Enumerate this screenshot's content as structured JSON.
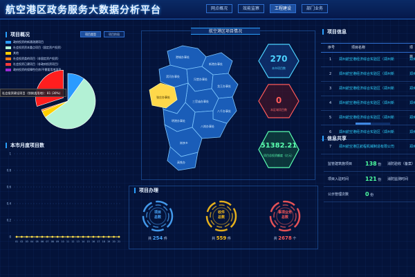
{
  "header": {
    "title": "航空港区政务服务大数据分析平台",
    "nav": [
      "网点概况",
      "效能监察",
      "工程建设",
      "部门业务"
    ],
    "active_nav": 2
  },
  "overview": {
    "title": "项目概况",
    "tabs": [
      "项目类型",
      "项目阶段"
    ],
    "legend": [
      {
        "label": "政府投资的新建改建项目",
        "color": "#2a9bff"
      },
      {
        "label": "社会投资资本重点项目（固定资产投资）",
        "color": "#b3f1d5"
      },
      {
        "label": "其他",
        "color": "#ffd000"
      },
      {
        "label": "社会投资类的项目（非固定资产投资）",
        "color": "#ff7a1a"
      },
      {
        "label": "社会投资已建项目（非政府投资项目）",
        "color": "#ff3b3b"
      },
      {
        "label": "政府投资的保障性住房/不需要用地项目",
        "color": "#9b2bd6"
      }
    ],
    "tooltip": "社会投资建设项目（划拨类用地）：81 (30%)"
  },
  "chart_data": [
    {
      "type": "pie",
      "categories": [
        "政府投资的新建改建项目",
        "社会投资资本重点项目（固定资产投资）",
        "其他",
        "社会投资类的项目（非固定资产投资）",
        "社会投资已建项目（非政府投资项目）"
      ],
      "values": [
        0.1,
        0.55,
        0.04,
        0.01,
        0.3
      ],
      "colors": [
        "#2a9bff",
        "#b3f1d5",
        "#ffd000",
        "#ff7a1a",
        "#ff1e1e"
      ]
    },
    {
      "type": "line",
      "title": "本市月度项目数",
      "categories": [
        "01",
        "02",
        "03",
        "04",
        "05",
        "06",
        "07",
        "08",
        "09",
        "10",
        "11",
        "12",
        "13",
        "14",
        "15",
        "16",
        "17",
        "18",
        "19",
        "20",
        "21"
      ],
      "values": [
        0,
        0,
        0,
        0,
        0,
        0,
        0,
        0,
        0,
        0,
        0,
        0,
        0,
        0,
        0,
        0,
        0,
        0,
        0,
        0,
        0
      ],
      "yticks": [
        0,
        0.2,
        0.4,
        0.6,
        0.8,
        1
      ],
      "ylim": [
        0,
        1
      ]
    }
  ],
  "map": {
    "title": "航空港区项目情况",
    "districts": [
      "港城办事处",
      "新港办事处",
      "滨河办事处",
      "冯堂办事处",
      "龙王办事处",
      "张庄办事处",
      "三官庙办事处",
      "八千办事处",
      "明港办事处",
      "八岗办事处",
      "岗李乡",
      "高铁办"
    ]
  },
  "kpi": [
    {
      "value": "270",
      "label": "本市项目数",
      "color": "#4dd2ff"
    },
    {
      "value": "0",
      "label": "本区域项目数",
      "color": "#ff5a5a"
    },
    {
      "value": "51382.21",
      "label": "项目总投资额度（亿元）",
      "color": "#5affb0"
    }
  ],
  "project_info": {
    "title": "项目信息",
    "columns": [
      "序号",
      "项目名称",
      "项目"
    ],
    "rows": [
      {
        "no": "1",
        "name": "郑州航空港经济综合实验区（郑州新",
        "tag": "郑州"
      },
      {
        "no": "2",
        "name": "郑州航空港经济综合实验区（郑州新",
        "tag": "郑州"
      },
      {
        "no": "3",
        "name": "郑州航空港经济综合实验区（郑州新",
        "tag": "郑州"
      },
      {
        "no": "4",
        "name": "郑州航空港经济综合实验区（郑州新",
        "tag": "郑州"
      },
      {
        "no": "5",
        "name": "郑州航空港经济综合实验区（郑州新",
        "tag": "郑州"
      },
      {
        "no": "6",
        "name": "郑州航空港经济综合实验区（郑州新",
        "tag": "郑州"
      },
      {
        "no": "7",
        "name": "郑州航空港区航程机械制造有限公司",
        "tag": "郑州"
      }
    ]
  },
  "share": {
    "title": "信息共享",
    "rows": [
      {
        "left": "监管建筑施项目",
        "num": "138",
        "unit": "份",
        "right": "消防验收（备案）"
      },
      {
        "left": "项目入驻时间",
        "num": "121",
        "unit": "份",
        "right": "消防监测时间"
      },
      {
        "left": "公示管理次数",
        "num": "0",
        "unit": "份",
        "right": ""
      }
    ]
  },
  "handling": {
    "title": "项目办理",
    "rings": [
      {
        "center1": "项目",
        "center2": "总数",
        "text": "共",
        "num": "254",
        "unit": "件",
        "color": "#4aa8ff"
      },
      {
        "center1": "收件",
        "center2": "总数",
        "text": "共",
        "num": "559",
        "unit": "件",
        "color": "#ffc21a"
      },
      {
        "center1": "事项业务",
        "center2": "总数",
        "text": "共",
        "num": "2678",
        "unit": "个",
        "color": "#ff5a5a"
      }
    ]
  }
}
